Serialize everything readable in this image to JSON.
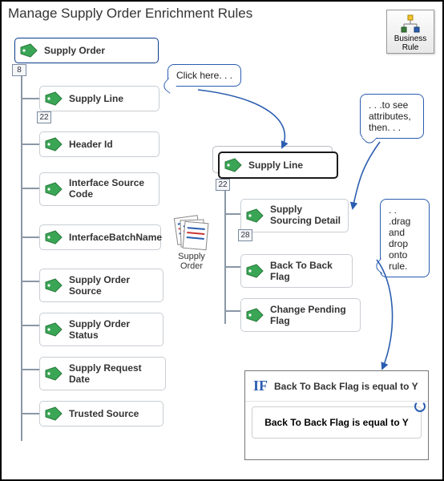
{
  "title": "Manage Supply Order Enrichment Rules",
  "badge": {
    "label": "Business Rule"
  },
  "callouts": {
    "click": "Click here. . .",
    "attrs": ". . .to see attributes, then. . .",
    "drag": ". . .drag and drop onto rule."
  },
  "doc_label": "Supply Order",
  "left_tree": {
    "root": {
      "label": "Supply Order",
      "count": "8"
    },
    "children": [
      {
        "label": "Supply Line",
        "count": "22"
      },
      {
        "label": "Header Id"
      },
      {
        "label": "Interface Source Code"
      },
      {
        "label": "InterfaceBatchName"
      },
      {
        "label": "Supply Order Source"
      },
      {
        "label": "Supply Order Status"
      },
      {
        "label": "Supply Request Date"
      },
      {
        "label": "Trusted Source"
      }
    ]
  },
  "right_tree": {
    "root": {
      "label": "Supply Line",
      "count": "22"
    },
    "children": [
      {
        "label": "Supply Sourcing Detail",
        "count": "28"
      },
      {
        "label": "Back To Back Flag"
      },
      {
        "label": "Change Pending Flag"
      }
    ]
  },
  "rule": {
    "if_keyword": "IF",
    "condition": "Back To Back Flag is equal to Y",
    "inner": "Back To Back Flag is equal to Y"
  }
}
